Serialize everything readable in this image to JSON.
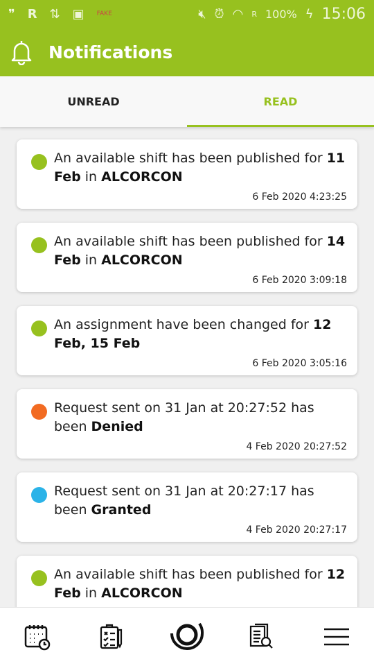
{
  "status_bar": {
    "battery": "100%",
    "time": "15:06",
    "signal_label": "R",
    "fake_label": "FAKE"
  },
  "header": {
    "title": "Notifications",
    "icon": "bell-icon"
  },
  "tabs": [
    {
      "label": "UNREAD",
      "active": false
    },
    {
      "label": "READ",
      "active": true
    }
  ],
  "colors": {
    "brand": "#97c11f",
    "green": "#97c11f",
    "orange": "#f26b22",
    "blue": "#2bb3e8"
  },
  "notifications": [
    {
      "parts": [
        {
          "t": "An available shift has been published for "
        },
        {
          "t": "11 Feb",
          "b": true
        },
        {
          "t": " in "
        },
        {
          "t": "ALCORCON",
          "b": true
        }
      ],
      "timestamp": "6 Feb 2020 4:23:25",
      "status": "green"
    },
    {
      "parts": [
        {
          "t": "An available shift has been published for "
        },
        {
          "t": "14 Feb",
          "b": true
        },
        {
          "t": " in "
        },
        {
          "t": "ALCORCON",
          "b": true
        }
      ],
      "timestamp": "6 Feb 2020 3:09:18",
      "status": "green"
    },
    {
      "parts": [
        {
          "t": "An assignment have been changed for "
        },
        {
          "t": "12 Feb, 15 Feb",
          "b": true
        }
      ],
      "timestamp": "6 Feb 2020 3:05:16",
      "status": "green"
    },
    {
      "parts": [
        {
          "t": "Request sent on 31 Jan at 20:27:52 has been "
        },
        {
          "t": "Denied",
          "b": true
        }
      ],
      "timestamp": "4 Feb 2020 20:27:52",
      "status": "orange"
    },
    {
      "parts": [
        {
          "t": "Request sent on 31 Jan at 20:27:17 has been "
        },
        {
          "t": "Granted",
          "b": true
        }
      ],
      "timestamp": "4 Feb 2020 20:27:17",
      "status": "blue"
    },
    {
      "parts": [
        {
          "t": "An available shift has been published for "
        },
        {
          "t": "12 Feb",
          "b": true
        },
        {
          "t": " in "
        },
        {
          "t": "ALCORCON",
          "b": true
        }
      ],
      "timestamp": "",
      "status": "green"
    }
  ],
  "bottom_nav": [
    "calendar-clock-icon",
    "checklist-icon",
    "home-logo-icon",
    "document-search-icon",
    "menu-icon"
  ]
}
